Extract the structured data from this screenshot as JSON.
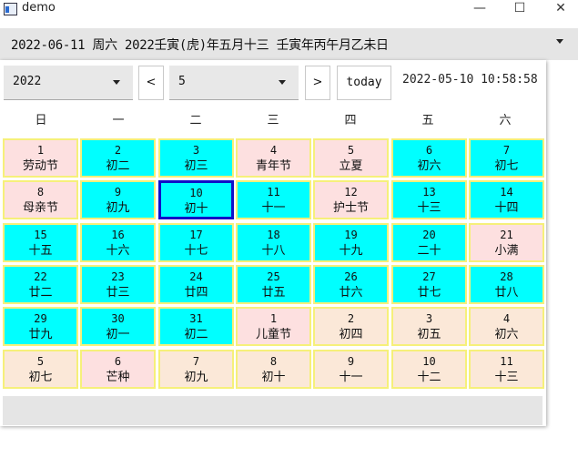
{
  "window": {
    "title": "demo",
    "minimize": "—",
    "maximize": "☐",
    "close": "✕"
  },
  "combo": {
    "text": "2022-06-11 周六 2022壬寅(虎)年五月十三 壬寅年丙午月乙未日"
  },
  "calendar": {
    "year": "2022",
    "month": "5",
    "prev_label": "<",
    "next_label": ">",
    "today_label": "today",
    "clock": "2022-05-10 10:58:58",
    "weekdays": [
      "日",
      "一",
      "二",
      "三",
      "四",
      "五",
      "六"
    ],
    "weeks": [
      [
        {
          "d": "1",
          "l": "劳动节",
          "t": "hol"
        },
        {
          "d": "2",
          "l": "初二",
          "t": "cur"
        },
        {
          "d": "3",
          "l": "初三",
          "t": "cur"
        },
        {
          "d": "4",
          "l": "青年节",
          "t": "hol"
        },
        {
          "d": "5",
          "l": "立夏",
          "t": "hol"
        },
        {
          "d": "6",
          "l": "初六",
          "t": "cur"
        },
        {
          "d": "7",
          "l": "初七",
          "t": "cur"
        }
      ],
      [
        {
          "d": "8",
          "l": "母亲节",
          "t": "hol"
        },
        {
          "d": "9",
          "l": "初九",
          "t": "cur"
        },
        {
          "d": "10",
          "l": "初十",
          "t": "cur",
          "selected": true
        },
        {
          "d": "11",
          "l": "十一",
          "t": "cur"
        },
        {
          "d": "12",
          "l": "护士节",
          "t": "hol"
        },
        {
          "d": "13",
          "l": "十三",
          "t": "cur"
        },
        {
          "d": "14",
          "l": "十四",
          "t": "cur"
        }
      ],
      [
        {
          "d": "15",
          "l": "十五",
          "t": "cur"
        },
        {
          "d": "16",
          "l": "十六",
          "t": "cur"
        },
        {
          "d": "17",
          "l": "十七",
          "t": "cur"
        },
        {
          "d": "18",
          "l": "十八",
          "t": "cur"
        },
        {
          "d": "19",
          "l": "十九",
          "t": "cur"
        },
        {
          "d": "20",
          "l": "二十",
          "t": "cur"
        },
        {
          "d": "21",
          "l": "小满",
          "t": "hol"
        }
      ],
      [
        {
          "d": "22",
          "l": "廿二",
          "t": "cur"
        },
        {
          "d": "23",
          "l": "廿三",
          "t": "cur"
        },
        {
          "d": "24",
          "l": "廿四",
          "t": "cur"
        },
        {
          "d": "25",
          "l": "廿五",
          "t": "cur"
        },
        {
          "d": "26",
          "l": "廿六",
          "t": "cur"
        },
        {
          "d": "27",
          "l": "廿七",
          "t": "cur"
        },
        {
          "d": "28",
          "l": "廿八",
          "t": "cur"
        }
      ],
      [
        {
          "d": "29",
          "l": "廿九",
          "t": "cur"
        },
        {
          "d": "30",
          "l": "初一",
          "t": "cur"
        },
        {
          "d": "31",
          "l": "初二",
          "t": "cur"
        },
        {
          "d": "1",
          "l": "儿童节",
          "t": "hol"
        },
        {
          "d": "2",
          "l": "初四",
          "t": "oth"
        },
        {
          "d": "3",
          "l": "初五",
          "t": "oth"
        },
        {
          "d": "4",
          "l": "初六",
          "t": "oth"
        }
      ],
      [
        {
          "d": "5",
          "l": "初七",
          "t": "oth"
        },
        {
          "d": "6",
          "l": "芒种",
          "t": "hol"
        },
        {
          "d": "7",
          "l": "初九",
          "t": "oth"
        },
        {
          "d": "8",
          "l": "初十",
          "t": "oth"
        },
        {
          "d": "9",
          "l": "十一",
          "t": "oth"
        },
        {
          "d": "10",
          "l": "十二",
          "t": "oth"
        },
        {
          "d": "11",
          "l": "十三",
          "t": "oth"
        }
      ]
    ]
  },
  "colors": {
    "current_month": "#00ffff",
    "holiday": "#fde0e0",
    "other_month": "#fbe8d8",
    "cell_border": "#f6f07a",
    "selected_border": "#1010c8"
  }
}
